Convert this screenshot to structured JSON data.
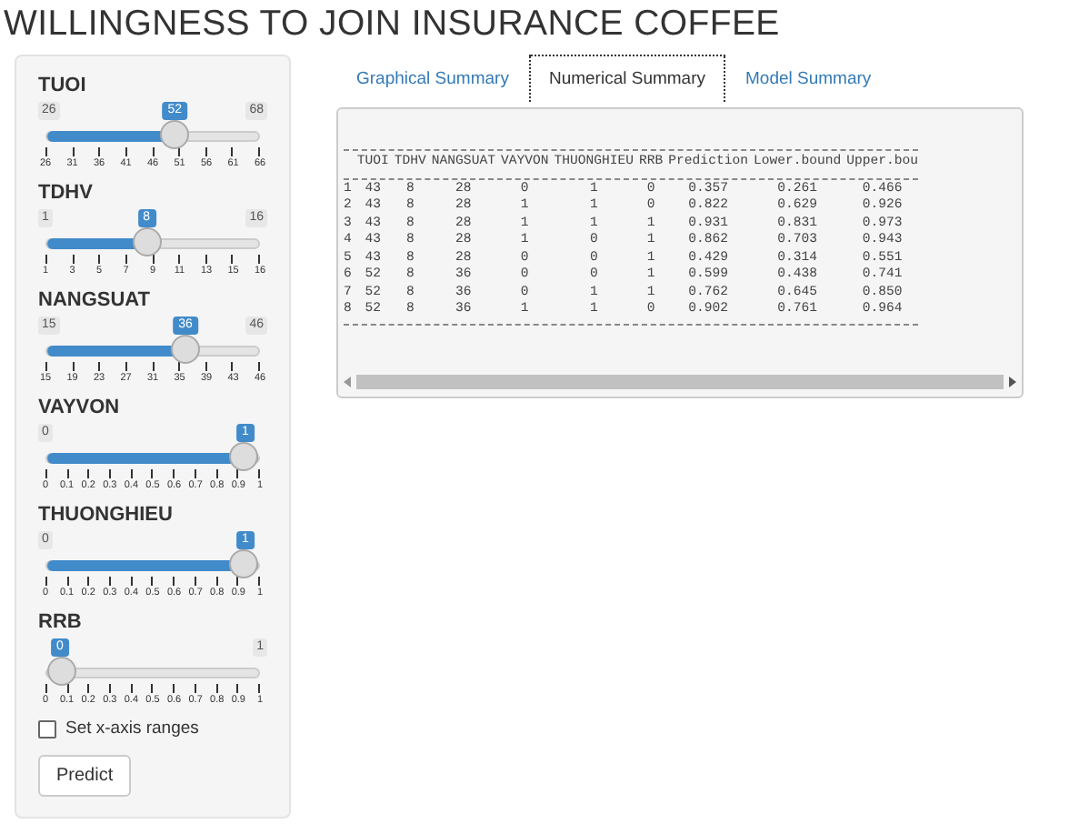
{
  "title": "WILLINGNESS TO JOIN INSURANCE COFFEE",
  "sliders": [
    {
      "label": "TUOI",
      "min": "26",
      "max": "68",
      "value": "52",
      "level": 0.619,
      "ticks": [
        "26",
        "31",
        "36",
        "41",
        "46",
        "51",
        "56",
        "61",
        "66"
      ]
    },
    {
      "label": "TDHV",
      "min": "1",
      "max": "16",
      "value": "8",
      "level": 0.467,
      "ticks": [
        "1",
        "3",
        "5",
        "7",
        "9",
        "11",
        "13",
        "15",
        "16"
      ]
    },
    {
      "label": "NANGSUAT",
      "min": "15",
      "max": "46",
      "value": "36",
      "level": 0.677,
      "ticks": [
        "15",
        "19",
        "23",
        "27",
        "31",
        "35",
        "39",
        "43",
        "46"
      ]
    },
    {
      "label": "VAYVON",
      "min": "0",
      "value": "1",
      "level": 1,
      "ticks": [
        "0",
        "0.1",
        "0.2",
        "0.3",
        "0.4",
        "0.5",
        "0.6",
        "0.7",
        "0.8",
        "0.9",
        "1"
      ]
    },
    {
      "label": "THUONGHIEU",
      "min": "0",
      "value": "1",
      "level": 1,
      "ticks": [
        "0",
        "0.1",
        "0.2",
        "0.3",
        "0.4",
        "0.5",
        "0.6",
        "0.7",
        "0.8",
        "0.9",
        "1"
      ]
    },
    {
      "label": "RRB",
      "max": "1",
      "value": "0",
      "level": 0,
      "ticks": [
        "0",
        "0.1",
        "0.2",
        "0.3",
        "0.4",
        "0.5",
        "0.6",
        "0.7",
        "0.8",
        "0.9",
        "1"
      ]
    }
  ],
  "checkbox": {
    "label": "Set x-axis ranges",
    "checked": false
  },
  "button": "Predict",
  "tabs": [
    {
      "label": "Graphical Summary",
      "selected": false
    },
    {
      "label": "Numerical Summary",
      "selected": true
    },
    {
      "label": "Model Summary",
      "selected": false
    }
  ],
  "table": {
    "columns": [
      "TUOI",
      "TDHV",
      "NANGSUAT",
      "VAYVON",
      "THUONGHIEU",
      "RRB",
      "Prediction",
      "Lower.bound",
      "Upper.bou"
    ],
    "rows": [
      {
        "index": "1",
        "cells": [
          "43",
          "8",
          "28",
          "0",
          "1",
          "0",
          "0.357",
          "0.261",
          "0.466"
        ]
      },
      {
        "index": "2",
        "cells": [
          "43",
          "8",
          "28",
          "1",
          "1",
          "0",
          "0.822",
          "0.629",
          "0.926"
        ]
      },
      {
        "index": "3",
        "cells": [
          "43",
          "8",
          "28",
          "1",
          "1",
          "1",
          "0.931",
          "0.831",
          "0.973"
        ]
      },
      {
        "index": "4",
        "cells": [
          "43",
          "8",
          "28",
          "1",
          "0",
          "1",
          "0.862",
          "0.703",
          "0.943"
        ]
      },
      {
        "index": "5",
        "cells": [
          "43",
          "8",
          "28",
          "0",
          "0",
          "1",
          "0.429",
          "0.314",
          "0.551"
        ]
      },
      {
        "index": "6",
        "cells": [
          "52",
          "8",
          "36",
          "0",
          "0",
          "1",
          "0.599",
          "0.438",
          "0.741"
        ]
      },
      {
        "index": "7",
        "cells": [
          "52",
          "8",
          "36",
          "0",
          "1",
          "1",
          "0.762",
          "0.645",
          "0.850"
        ]
      },
      {
        "index": "8",
        "cells": [
          "52",
          "8",
          "36",
          "1",
          "1",
          "0",
          "0.902",
          "0.761",
          "0.964"
        ]
      }
    ]
  }
}
